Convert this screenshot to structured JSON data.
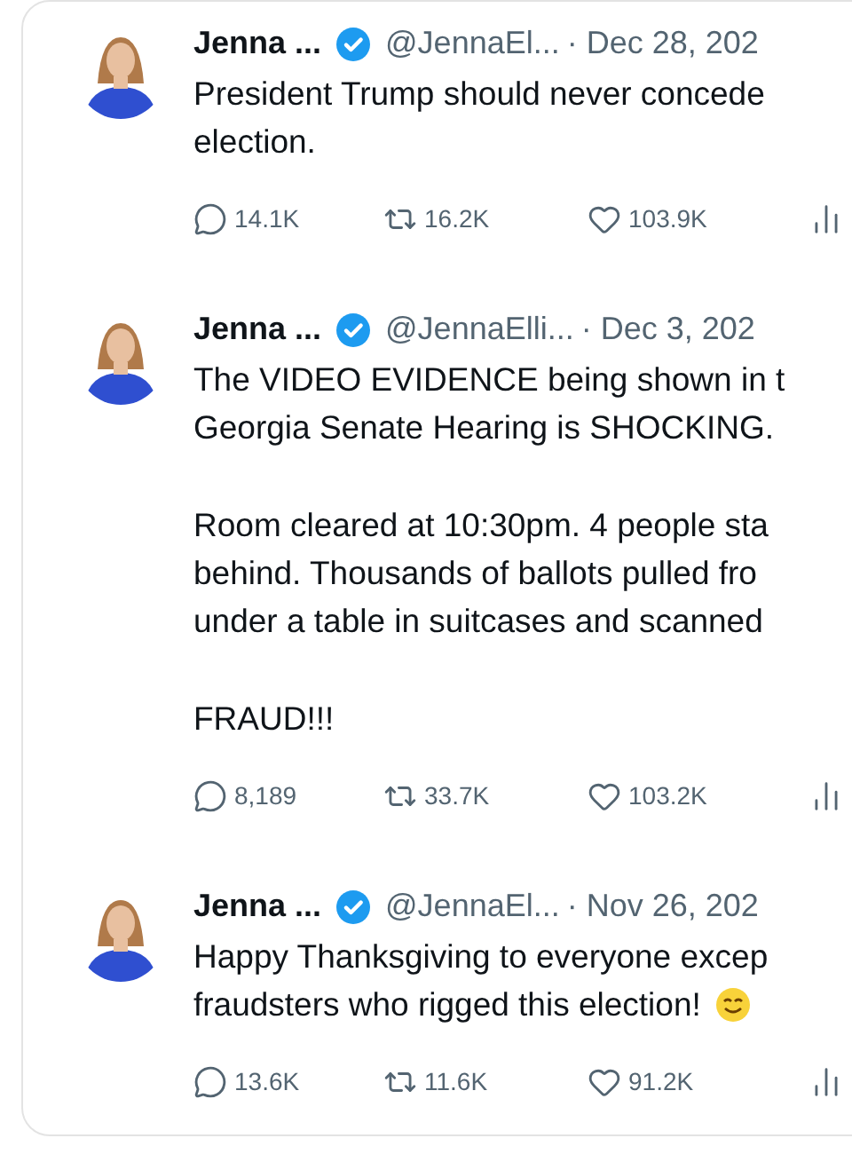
{
  "tweets": [
    {
      "name": "Jenna ...",
      "verified": true,
      "handle": "@JennaEl...",
      "date": "· Dec 28, 202",
      "paragraphs": [
        [
          "President Trump should never concede",
          "election."
        ]
      ],
      "emoji": false,
      "stats": {
        "replies": "14.1K",
        "reposts": "16.2K",
        "likes": "103.9K"
      }
    },
    {
      "name": "Jenna ...",
      "verified": true,
      "handle": "@JennaElli...",
      "date": "· Dec 3, 202",
      "paragraphs": [
        [
          "The VIDEO EVIDENCE being shown in t",
          "Georgia Senate Hearing is SHOCKING."
        ],
        [
          "Room cleared at 10:30pm. 4 people sta",
          "behind. Thousands of ballots pulled fro",
          "under a table in suitcases and scanned"
        ],
        [
          "FRAUD!!!"
        ]
      ],
      "emoji": false,
      "stats": {
        "replies": "8,189",
        "reposts": "33.7K",
        "likes": "103.2K"
      }
    },
    {
      "name": "Jenna ...",
      "verified": true,
      "handle": "@JennaEl...",
      "date": "· Nov 26, 202",
      "paragraphs": [
        [
          "Happy Thanksgiving to everyone excep",
          "fraudsters who rigged this election!"
        ]
      ],
      "emoji": true,
      "stats": {
        "replies": "13.6K",
        "reposts": "11.6K",
        "likes": "91.2K"
      }
    }
  ]
}
